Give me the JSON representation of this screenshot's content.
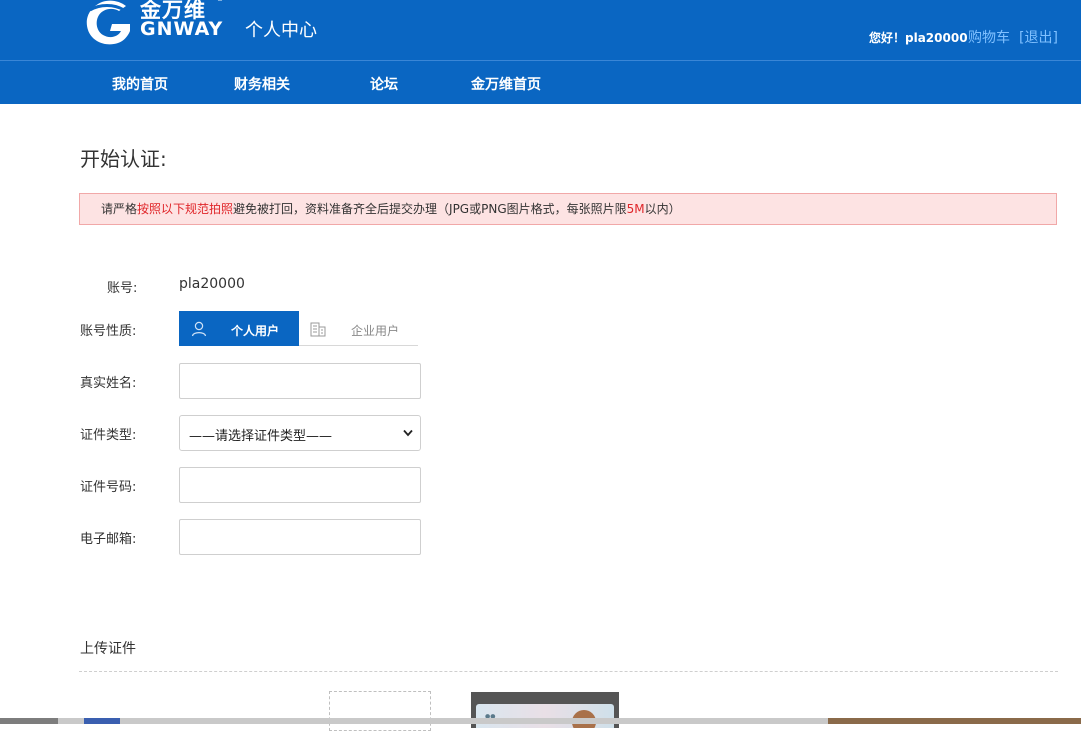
{
  "header": {
    "logo_cn": "金万维",
    "logo_en": "GNWAY",
    "logo_reg": "®",
    "center_title": "个人中心",
    "greeting": "您好！pla20000",
    "cart_label": "购物车",
    "logout_label": "[退出]"
  },
  "nav": {
    "items": [
      {
        "label": "我的首页"
      },
      {
        "label": "财务相关"
      },
      {
        "label": "论坛"
      },
      {
        "label": "金万维首页"
      }
    ]
  },
  "page": {
    "title": "开始认证:"
  },
  "notice": {
    "part1": "请严格",
    "part2_red": "按照以下规范拍照",
    "part3": "避免被打回，资料准备齐全后提交办理（JPG或PNG图片格式，每张照片限",
    "part4_red": "5M",
    "part5": "以内）"
  },
  "form": {
    "account_label": "账号:",
    "account_value": "pla20000",
    "account_type_label": "账号性质:",
    "tab_personal": "个人用户",
    "tab_enterprise": "企业用户",
    "realname_label": "真实姓名:",
    "realname_value": "",
    "id_type_label": "证件类型:",
    "id_type_selected": "——请选择证件类型——",
    "id_number_label": "证件号码:",
    "id_number_value": "",
    "email_label": "电子邮箱:",
    "email_value": ""
  },
  "upload": {
    "title": "上传证件"
  },
  "colors": {
    "brand_blue": "#0a66c2",
    "notice_bg": "#fde3e3",
    "notice_red": "#e0262a",
    "link_blue": "#7fc0ff"
  }
}
